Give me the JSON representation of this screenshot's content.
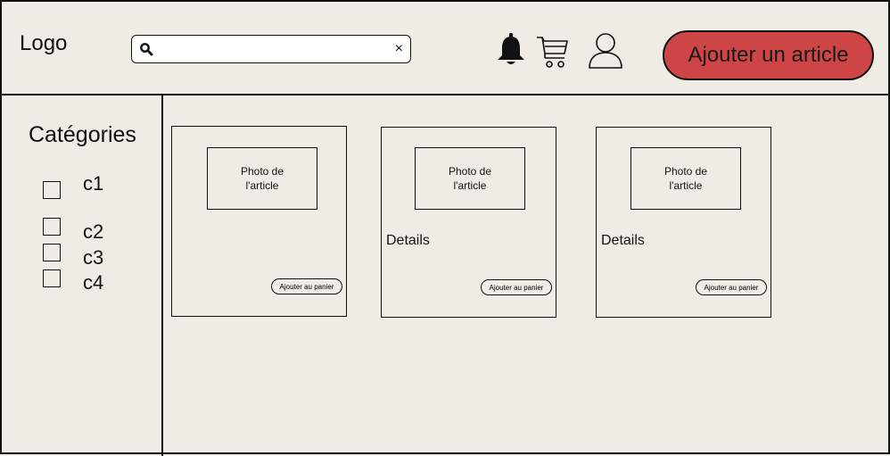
{
  "header": {
    "logo": "Logo",
    "search": {
      "value": "",
      "placeholder": "",
      "clear_symbol": "×"
    },
    "icons": [
      "bell-icon",
      "cart-icon",
      "user-icon"
    ],
    "add_article_label": "Ajouter un article"
  },
  "sidebar": {
    "title": "Catégories",
    "categories": [
      {
        "label": "c1",
        "checked": false
      },
      {
        "label": "c2",
        "checked": false
      },
      {
        "label": "c3",
        "checked": false
      },
      {
        "label": "c4",
        "checked": false
      }
    ]
  },
  "products": [
    {
      "photo_label": "Photo de\nl'article",
      "details": "",
      "button_label": "Ajouter au panier"
    },
    {
      "photo_label": "Photo de\nl'article",
      "details": "Details",
      "button_label": "Ajouter au panier"
    },
    {
      "photo_label": "Photo de\nl'article",
      "details": "Details",
      "button_label": "Ajouter au panier"
    }
  ],
  "colors": {
    "background": "#efebe5",
    "accent": "#cd4545",
    "stroke": "#111111"
  }
}
